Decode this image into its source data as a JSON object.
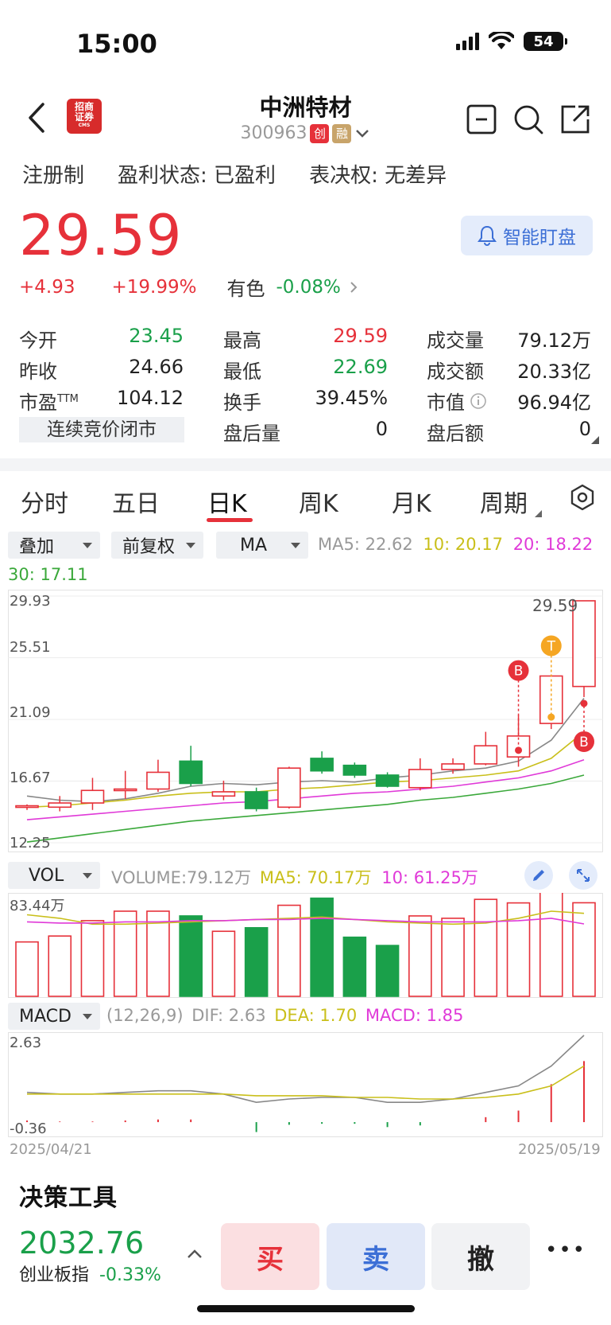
{
  "status_bar": {
    "time": "15:00",
    "battery": "54"
  },
  "header": {
    "broker_logo": [
      "招商",
      "证券",
      "CMS"
    ],
    "stock_name": "中洲特材",
    "stock_code": "300963",
    "tags": [
      "创",
      "融"
    ]
  },
  "info_row": {
    "registration": "注册制",
    "profit_label": "盈利状态:",
    "profit_value": "已盈利",
    "voting_label": "表决权:",
    "voting_value": "无差异"
  },
  "price": {
    "last": "29.59",
    "change": "+4.93",
    "change_pct": "+19.99%",
    "sector_name": "有色",
    "sector_change": "-0.08%",
    "smart_watch_label": "智能盯盘"
  },
  "quote": {
    "open_label": "今开",
    "open": "23.45",
    "prev_close_label": "昨收",
    "prev_close": "24.66",
    "pe_label": "市盈",
    "pe_sup": "TTM",
    "pe": "104.12",
    "high_label": "最高",
    "high": "29.59",
    "low_label": "最低",
    "low": "22.69",
    "turnover_label": "换手",
    "turnover": "39.45%",
    "after_volume_label": "盘后量",
    "after_volume": "0",
    "volume_label": "成交量",
    "volume": "79.12万",
    "amount_label": "成交额",
    "amount": "20.33亿",
    "mcap_label": "市值",
    "mcap": "96.94亿",
    "after_amount_label": "盘后额",
    "after_amount": "0",
    "auction_status": "连续竞价闭市"
  },
  "tabs": [
    "分时",
    "五日",
    "日K",
    "周K",
    "月K",
    "周期"
  ],
  "active_tab": 2,
  "chart_controls": {
    "overlay": "叠加",
    "adjust": "前复权",
    "indicator": "MA",
    "ma5": "MA5: 22.62",
    "ma10": "10: 20.17",
    "ma20": "20: 18.22",
    "ma30": "30: 17.11",
    "vol_selector": "VOL",
    "vol_volume": "VOLUME:79.12万",
    "vol_ma5": "MA5: 70.17万",
    "vol_ma10": "10: 61.25万",
    "macd_selector": "MACD",
    "macd_params": "(12,26,9)",
    "macd_dif": "DIF: 2.63",
    "macd_dea": "DEA: 1.70",
    "macd_macd": "MACD: 1.85"
  },
  "colors": {
    "up": "#e6313a",
    "down": "#1aa04a",
    "ma5": "#888888",
    "ma10": "#c9bf1a",
    "ma20": "#e03ad8",
    "ma30": "#3aa83a",
    "accent": "#3c6fd6"
  },
  "chart_data": [
    {
      "type": "candlestick",
      "y_ticks": [
        "29.93",
        "25.51",
        "21.09",
        "16.67",
        "12.25"
      ],
      "ylim": [
        12.25,
        29.93
      ],
      "max_label": "29.59",
      "markers": [
        {
          "label": "B",
          "index": 15
        },
        {
          "label": "T",
          "index": 16
        },
        {
          "label": "B",
          "index": 17
        }
      ],
      "candles": [
        {
          "o": 14.8,
          "c": 14.9,
          "h": 15.0,
          "l": 14.6
        },
        {
          "o": 14.8,
          "c": 15.1,
          "h": 15.6,
          "l": 14.5
        },
        {
          "o": 15.1,
          "c": 16.0,
          "h": 16.9,
          "l": 14.6
        },
        {
          "o": 16.0,
          "c": 16.1,
          "h": 17.4,
          "l": 15.4
        },
        {
          "o": 16.1,
          "c": 17.3,
          "h": 18.2,
          "l": 15.9
        },
        {
          "o": 18.1,
          "c": 16.5,
          "h": 19.2,
          "l": 16.3
        },
        {
          "o": 15.6,
          "c": 15.9,
          "h": 16.7,
          "l": 15.3
        },
        {
          "o": 15.9,
          "c": 14.7,
          "h": 16.2,
          "l": 14.5
        },
        {
          "o": 14.8,
          "c": 17.6,
          "h": 17.7,
          "l": 14.7
        },
        {
          "o": 18.3,
          "c": 17.4,
          "h": 18.8,
          "l": 17.2
        },
        {
          "o": 17.8,
          "c": 17.1,
          "h": 18.0,
          "l": 16.9
        },
        {
          "o": 17.1,
          "c": 16.3,
          "h": 17.3,
          "l": 16.2
        },
        {
          "o": 16.2,
          "c": 17.5,
          "h": 18.3,
          "l": 16.0
        },
        {
          "o": 17.5,
          "c": 17.9,
          "h": 18.3,
          "l": 17.2
        },
        {
          "o": 17.9,
          "c": 19.2,
          "h": 20.2,
          "l": 17.8
        },
        {
          "o": 18.4,
          "c": 19.9,
          "h": 21.4,
          "l": 17.7
        },
        {
          "o": 20.8,
          "c": 24.2,
          "h": 24.3,
          "l": 20.4
        },
        {
          "o": 23.45,
          "c": 29.59,
          "h": 29.59,
          "l": 22.69
        }
      ],
      "ma_series": [
        {
          "key": "ma5",
          "values": [
            15.6,
            15.3,
            15.2,
            15.4,
            15.8,
            16.3,
            16.5,
            16.4,
            16.6,
            16.7,
            16.6,
            16.9,
            17.1,
            17.4,
            17.6,
            18.1,
            19.6,
            22.6
          ]
        },
        {
          "key": "ma10",
          "values": [
            14.8,
            14.9,
            15.1,
            15.3,
            15.6,
            15.8,
            15.9,
            15.9,
            16.1,
            16.2,
            16.4,
            16.6,
            16.7,
            16.9,
            17.1,
            17.4,
            18.3,
            20.2
          ]
        },
        {
          "key": "ma20",
          "values": [
            13.9,
            14.1,
            14.3,
            14.5,
            14.7,
            14.9,
            15.1,
            15.2,
            15.4,
            15.6,
            15.8,
            15.9,
            16.1,
            16.3,
            16.6,
            16.9,
            17.4,
            18.2
          ]
        },
        {
          "key": "ma30",
          "values": [
            12.3,
            12.6,
            12.9,
            13.2,
            13.5,
            13.8,
            14.0,
            14.2,
            14.4,
            14.6,
            14.8,
            15.0,
            15.3,
            15.5,
            15.8,
            16.1,
            16.5,
            17.1
          ]
        }
      ]
    },
    {
      "type": "bar",
      "name": "VOL",
      "y_max_label": "83.44万",
      "ylim": [
        0,
        83.44
      ],
      "values": [
        46,
        51,
        64,
        72,
        72,
        68,
        55,
        58,
        77,
        83,
        50,
        43,
        68,
        66,
        82,
        79,
        88,
        79.12
      ],
      "up": [
        true,
        true,
        true,
        true,
        true,
        false,
        true,
        false,
        true,
        false,
        false,
        false,
        true,
        true,
        true,
        true,
        true,
        true
      ],
      "ma5": [
        69,
        66,
        61,
        61,
        62,
        63,
        64,
        65,
        66,
        67,
        65,
        63,
        62,
        61,
        62,
        66,
        72,
        70.17
      ],
      "ma10": [
        63,
        62,
        62,
        63,
        63,
        64,
        64,
        65,
        65,
        66,
        65,
        64,
        63,
        63,
        63,
        64,
        66,
        61.25
      ]
    },
    {
      "type": "macd",
      "y_ticks": [
        "2.63",
        "-0.36"
      ],
      "ylim": [
        -0.36,
        2.63
      ],
      "dif": [
        0.9,
        0.85,
        0.85,
        0.9,
        0.95,
        0.95,
        0.85,
        0.6,
        0.7,
        0.75,
        0.75,
        0.6,
        0.6,
        0.7,
        0.9,
        1.1,
        1.7,
        2.63
      ],
      "dea": [
        0.85,
        0.85,
        0.85,
        0.85,
        0.85,
        0.85,
        0.85,
        0.8,
        0.8,
        0.8,
        0.75,
        0.75,
        0.7,
        0.7,
        0.75,
        0.85,
        1.1,
        1.7
      ],
      "hist": [
        0.05,
        0.02,
        0.02,
        0.05,
        0.08,
        0.08,
        0.0,
        -0.3,
        -0.08,
        -0.05,
        -0.05,
        -0.15,
        -0.1,
        0.0,
        0.15,
        0.35,
        1.15,
        1.85
      ],
      "x_start": "2025/04/21",
      "x_end": "2025/05/19"
    }
  ],
  "decision_tools": "决策工具",
  "bottom": {
    "index_value": "2032.76",
    "index_name": "创业板指",
    "index_change": "-0.33%",
    "buy": "买",
    "sell": "卖",
    "cancel": "撤",
    "more": "•••"
  }
}
